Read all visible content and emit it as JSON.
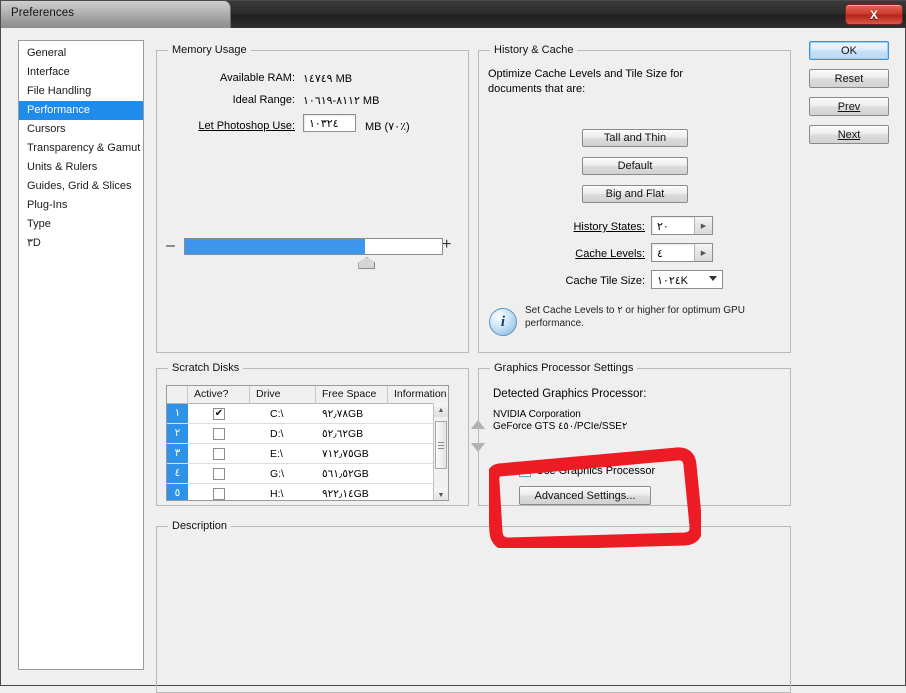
{
  "window": {
    "title": "Preferences",
    "close_label": "X",
    "close_icon": "close-icon"
  },
  "sidebar": {
    "items": [
      {
        "label": "General",
        "selected": false
      },
      {
        "label": "Interface",
        "selected": false
      },
      {
        "label": "File Handling",
        "selected": false
      },
      {
        "label": "Performance",
        "selected": true
      },
      {
        "label": "Cursors",
        "selected": false
      },
      {
        "label": "Transparency & Gamut",
        "selected": false
      },
      {
        "label": "Units & Rulers",
        "selected": false
      },
      {
        "label": "Guides, Grid & Slices",
        "selected": false
      },
      {
        "label": "Plug-Ins",
        "selected": false
      },
      {
        "label": "Type",
        "selected": false
      },
      {
        "label": "٣D",
        "selected": false
      }
    ]
  },
  "memory_usage": {
    "group_label": "Memory Usage",
    "available_ram_label": "Available RAM:",
    "available_ram_value": "١٤٧٤٩ MB",
    "ideal_range_label": "Ideal Range:",
    "ideal_range_value": "٨١١٢-١٠٦١٩ MB",
    "let_photoshop_use_label": "Let Photoshop Use:",
    "let_photoshop_use_value": "١٠٣٢٤",
    "unit_suffix": "MB (٧٠٪)",
    "slider_minus": "–",
    "slider_plus": "+",
    "slider_percent": 70
  },
  "history_cache": {
    "group_label": "History & Cache",
    "optimize_text_line1": "Optimize Cache Levels and Tile Size for",
    "optimize_text_line2": "documents that are:",
    "buttons": [
      {
        "label": "Tall and Thin"
      },
      {
        "label": "Default"
      },
      {
        "label": "Big and Flat"
      }
    ],
    "history_states_label": "History States:",
    "history_states_value": "٢٠",
    "cache_levels_label": "Cache Levels:",
    "cache_levels_value": "٤",
    "cache_tile_size_label": "Cache Tile Size:",
    "cache_tile_size_value": "١٠٢٤K",
    "info_icon": "info-icon",
    "info_text": "Set Cache Levels to ٢ or higher for optimum GPU performance."
  },
  "scratch_disks": {
    "group_label": "Scratch Disks",
    "columns": [
      "",
      "Active?",
      "Drive",
      "Free Space",
      "Information"
    ],
    "rows": [
      {
        "num": "١",
        "active": true,
        "drive": "C:\\",
        "free_space": "٩٢٫٧٨GB",
        "information": ""
      },
      {
        "num": "٢",
        "active": false,
        "drive": "D:\\",
        "free_space": "٥٢٫٦٢GB",
        "information": ""
      },
      {
        "num": "٣",
        "active": false,
        "drive": "E:\\",
        "free_space": "٧١٢٫٧٥GB",
        "information": ""
      },
      {
        "num": "٤",
        "active": false,
        "drive": "G:\\",
        "free_space": "٥٦١٫٥٢GB",
        "information": ""
      },
      {
        "num": "٥",
        "active": false,
        "drive": "H:\\",
        "free_space": "٩٢٢٫١٤GB",
        "information": ""
      }
    ],
    "checkmark": "✔"
  },
  "graphics_processor": {
    "group_label": "Graphics Processor Settings",
    "detected_label": "Detected Graphics Processor:",
    "vendor": "NVIDIA Corporation",
    "model": "GeForce GTS ٤٥٠/PCIe/SSE٢",
    "use_gpu_label": "Use Graphics Processor",
    "use_gpu_checked": true,
    "checkmark": "✔",
    "advanced_settings_label": "Advanced Settings..."
  },
  "description": {
    "group_label": "Description",
    "text": ""
  },
  "action_buttons": [
    {
      "label": "OK",
      "primary": true
    },
    {
      "label": "Reset",
      "primary": false
    },
    {
      "label": "Prev",
      "primary": false
    },
    {
      "label": "Next",
      "primary": false
    }
  ],
  "annotation": {
    "shape": "red-rounded-rectangle-highlight",
    "color": "#ed1c24"
  },
  "colors": {
    "selection_blue": "#1f8beb",
    "slider_blue": "#3d95ec",
    "row_number_blue": "#2e93e8",
    "annotation_red": "#ed1c24",
    "dialog_bg": "#efefef"
  }
}
